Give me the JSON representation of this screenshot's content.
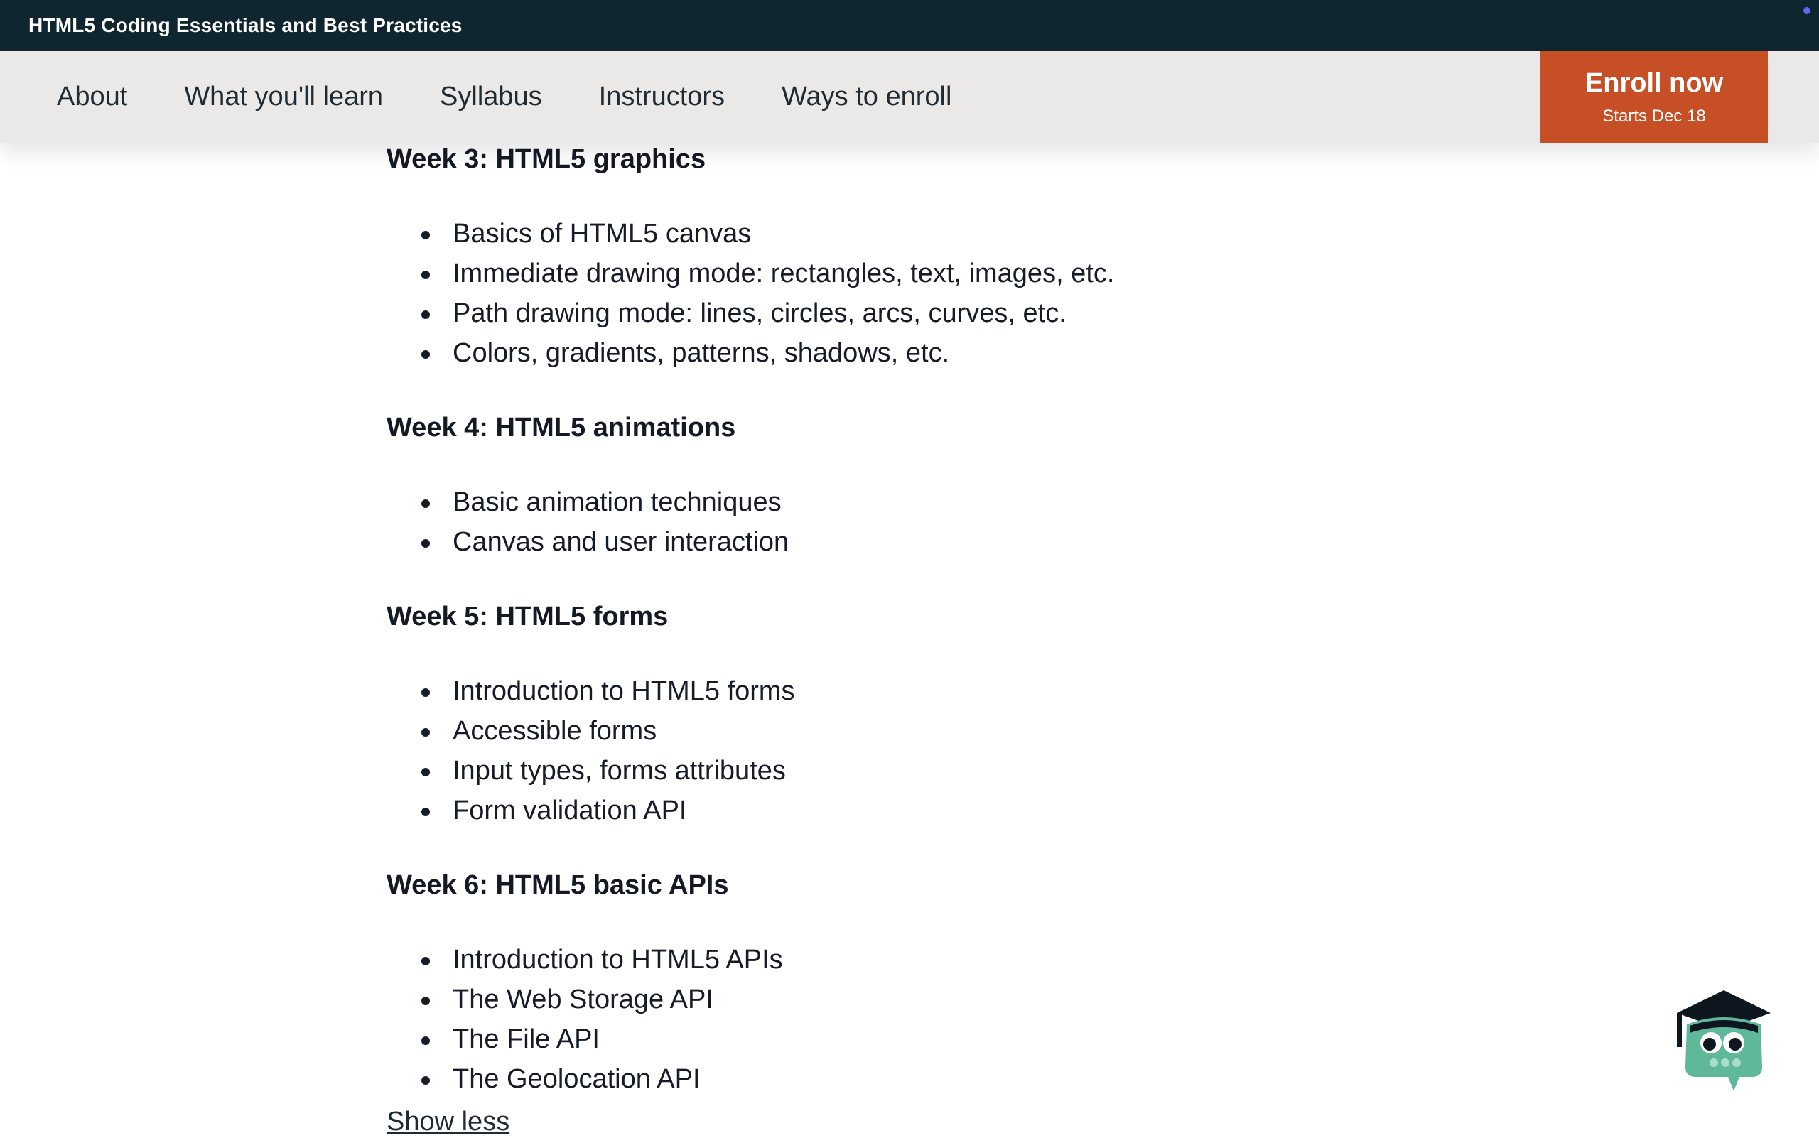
{
  "topbar": {
    "title": "HTML5 Coding Essentials and Best Practices"
  },
  "nav": {
    "links": [
      "About",
      "What you'll learn",
      "Syllabus",
      "Instructors",
      "Ways to enroll"
    ],
    "enroll_label": "Enroll now",
    "enroll_sub": "Starts Dec 18"
  },
  "syllabus": {
    "weeks": [
      {
        "title": "Week 3: HTML5 graphics",
        "items": [
          "Basics of HTML5 canvas",
          "Immediate drawing mode: rectangles, text, images, etc.",
          "Path drawing mode: lines, circles, arcs, curves, etc.",
          "Colors, gradients, patterns, shadows, etc."
        ]
      },
      {
        "title": "Week 4: HTML5 animations",
        "items": [
          "Basic animation techniques",
          "Canvas and user interaction"
        ]
      },
      {
        "title": "Week 5: HTML5 forms",
        "items": [
          "Introduction to HTML5 forms",
          "Accessible forms",
          "Input types, forms attributes",
          "Form validation API"
        ]
      },
      {
        "title": "Week 6: HTML5 basic APIs",
        "items": [
          "Introduction to HTML5 APIs",
          "The Web Storage API",
          "The File API",
          "The Geolocation API"
        ]
      }
    ],
    "show_less_label": "Show less"
  },
  "colors": {
    "topbar_bg": "#0f2530",
    "navbar_bg": "#ebe9e7",
    "enroll_bg": "#c64f26",
    "mascot_green": "#5fb89a"
  },
  "icons": {
    "mascot": "graduation-cap-mascot-icon"
  }
}
